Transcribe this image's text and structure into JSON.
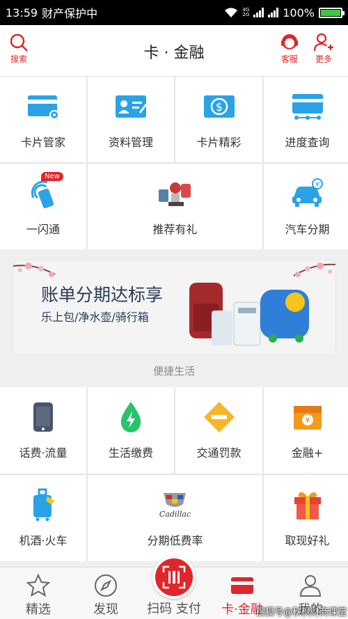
{
  "status_bar": {
    "time": "13:59",
    "app_status": "财产保护中",
    "network_small": "4G",
    "network_small2": "2G",
    "battery": "100%",
    "battery_level": 1.0
  },
  "header": {
    "title": "卡 · 金融",
    "search_label": "搜索",
    "service_label": "客服",
    "more_label": "更多"
  },
  "top_grid": {
    "items": [
      {
        "label": "卡片管家",
        "icon": "card-settings-icon"
      },
      {
        "label": "资料管理",
        "icon": "id-card-edit-icon"
      },
      {
        "label": "卡片精彩",
        "icon": "card-dollar-icon"
      },
      {
        "label": "进度查询",
        "icon": "card-progress-icon"
      },
      {
        "label": "一闪通",
        "icon": "nfc-phone-icon",
        "badge": "New"
      },
      {
        "label": "推荐有礼",
        "icon": "gift-products-icon"
      },
      {
        "label": "汽车分期",
        "icon": "car-yen-icon"
      }
    ]
  },
  "banner": {
    "title": "账单分期达标享",
    "subtitle": "乐上包/净水壶/骑行箱"
  },
  "section": {
    "title": "便捷生活"
  },
  "life_grid": {
    "items": [
      {
        "label": "话费·流量",
        "icon": "phone-icon"
      },
      {
        "label": "生活缴费",
        "icon": "bolt-drop-icon"
      },
      {
        "label": "交通罚款",
        "icon": "traffic-sign-icon"
      },
      {
        "label": "金融+",
        "icon": "yen-box-icon"
      },
      {
        "label": "机酒·火车",
        "icon": "luggage-icon"
      },
      {
        "label": "分期低费率",
        "icon": "cadillac-logo",
        "logo_text": "Cadillac"
      },
      {
        "label": "取现好礼",
        "icon": "gift-box-icon"
      }
    ]
  },
  "bottom_nav": {
    "items": [
      {
        "label": "精选",
        "icon": "star-icon"
      },
      {
        "label": "发现",
        "icon": "compass-icon"
      },
      {
        "label": "扫码 支付",
        "icon": "scan-icon"
      },
      {
        "label": "卡·金融",
        "icon": "card-icon"
      },
      {
        "label": "我的",
        "icon": "user-icon"
      }
    ]
  },
  "watermark": "搜狐号@秋枫财商课堂",
  "colors": {
    "accent": "#e0262b",
    "blue": "#2aa2e8",
    "green": "#3fc93f"
  }
}
